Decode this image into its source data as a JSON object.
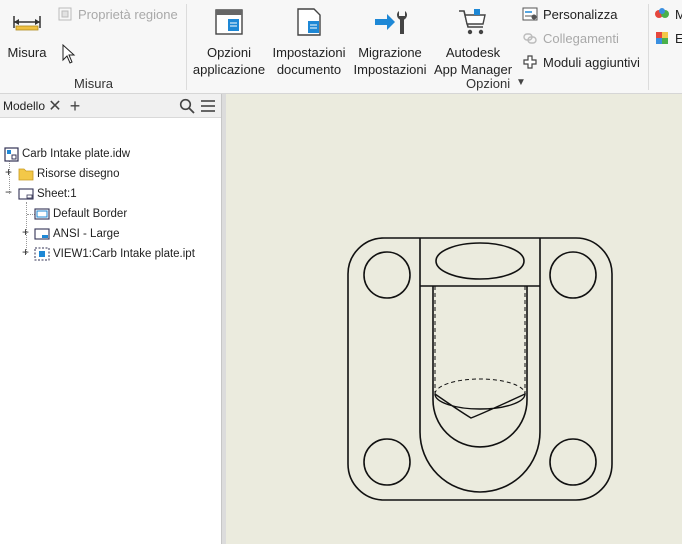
{
  "ribbon": {
    "measure_group": {
      "measure_button": "Misura",
      "region_properties": "Proprietà regione",
      "label": "Misura"
    },
    "options_group": {
      "app_options": [
        "Opzioni",
        "applicazione"
      ],
      "doc_settings": [
        "Impostazioni",
        "documento"
      ],
      "migrate_settings": [
        "Migrazione",
        "Impostazioni"
      ],
      "app_manager": [
        "Autodesk",
        "App Manager"
      ],
      "customize": "Personalizza",
      "links": "Collegamenti",
      "addins": "Moduli aggiuntivi",
      "label": "Opzioni"
    },
    "right_partial": [
      "M",
      "E"
    ]
  },
  "browser": {
    "tab": "Modello",
    "items": [
      {
        "label": "Carb Intake plate.idw"
      },
      {
        "label": "Risorse disegno"
      },
      {
        "label": "Sheet:1"
      },
      {
        "label": "Default Border"
      },
      {
        "label": "ANSI - Large"
      },
      {
        "label": "VIEW1:Carb Intake plate.ipt"
      }
    ]
  },
  "colors": {
    "ribbon_bg": "#f7f7f7",
    "canvas_bg": "#ebebde",
    "accent_blue": "#1e88d6",
    "folder_yellow": "#f3c848"
  }
}
